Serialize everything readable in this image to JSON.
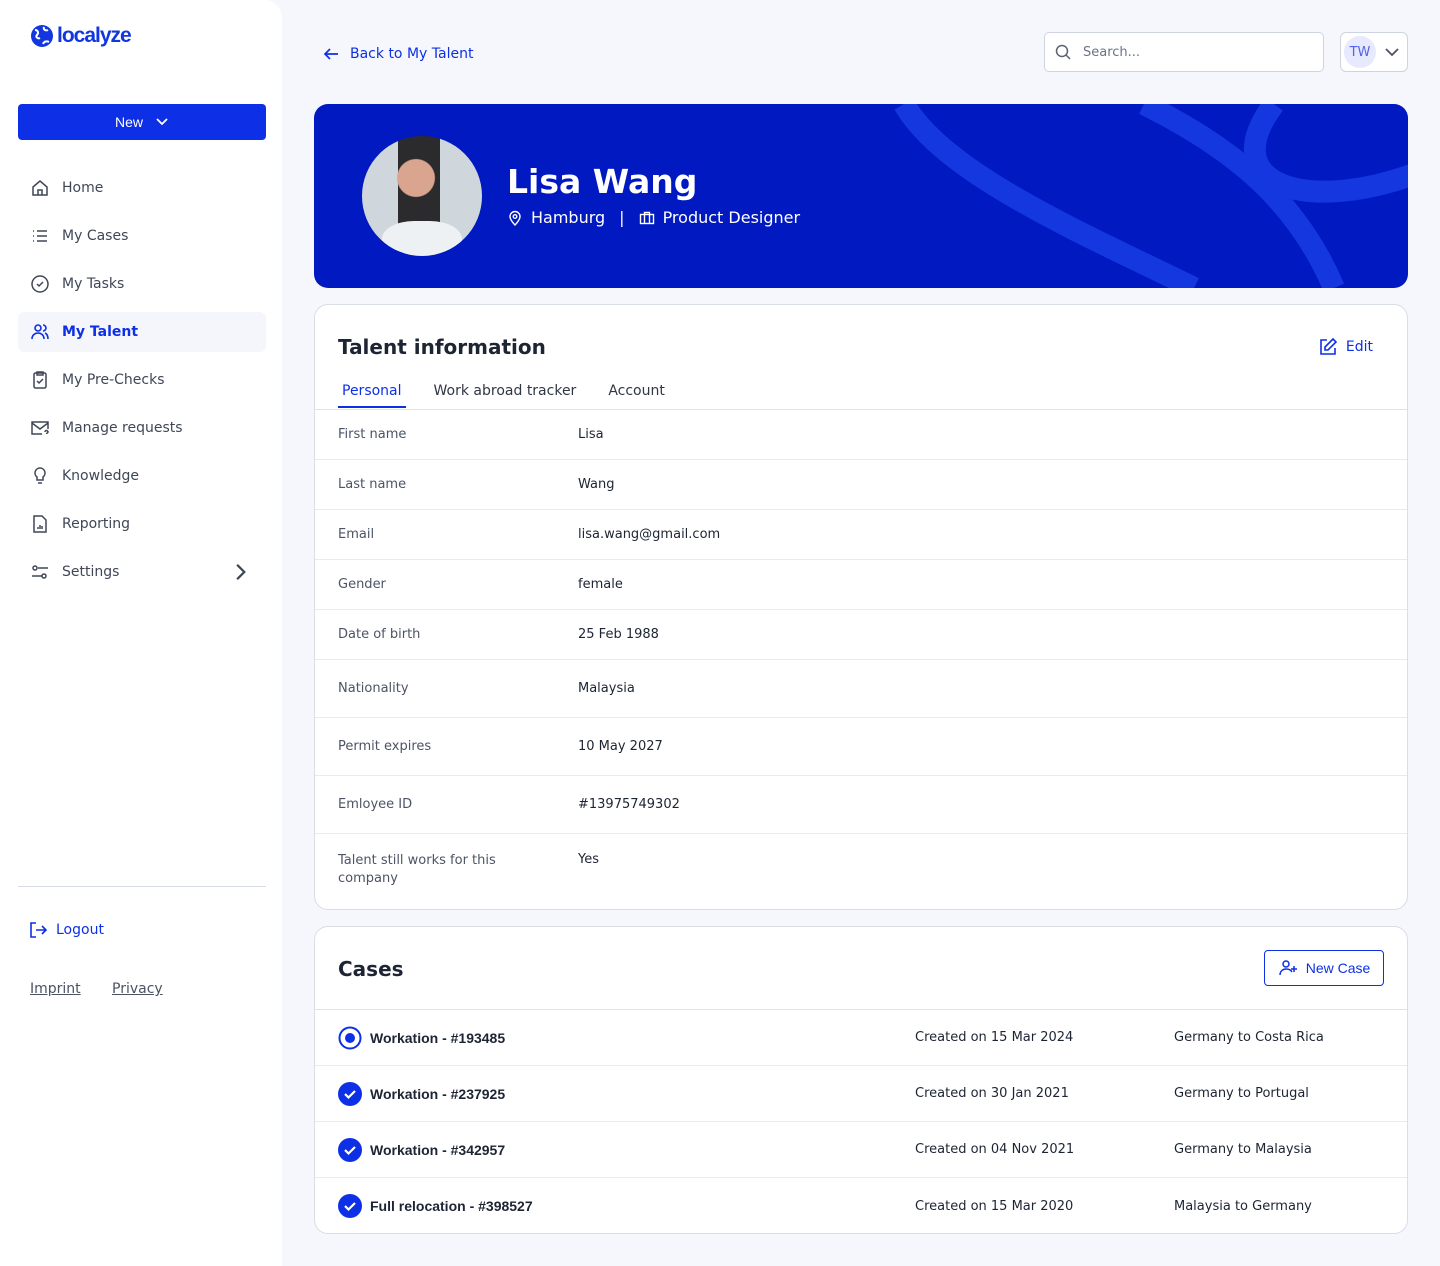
{
  "brand": {
    "name": "localyze",
    "accent": "#0d2fe6",
    "banner": "#0019c1"
  },
  "sidebar": {
    "new_label": "New",
    "items": [
      {
        "label": "Home",
        "icon": "home-icon"
      },
      {
        "label": "My Cases",
        "icon": "list-icon"
      },
      {
        "label": "My Tasks",
        "icon": "check-circle-icon"
      },
      {
        "label": "My Talent",
        "icon": "users-icon",
        "active": true
      },
      {
        "label": "My Pre-Checks",
        "icon": "clipboard-check-icon"
      },
      {
        "label": "Manage requests",
        "icon": "mail-question-icon"
      },
      {
        "label": "Knowledge",
        "icon": "lightbulb-icon"
      },
      {
        "label": "Reporting",
        "icon": "report-icon"
      },
      {
        "label": "Settings",
        "icon": "sliders-icon"
      }
    ],
    "logout": "Logout",
    "imprint": "Imprint",
    "privacy": "Privacy"
  },
  "header": {
    "back": "Back to My Talent",
    "search_placeholder": "Search...",
    "user_initials": "TW"
  },
  "profile": {
    "name": "Lisa Wang",
    "city": "Hamburg",
    "role": "Product Designer",
    "separator": "|"
  },
  "talent": {
    "title": "Talent information",
    "edit": "Edit",
    "tabs": [
      "Personal",
      "Work abroad tracker",
      "Account"
    ],
    "rows": [
      {
        "k": "First name",
        "v": "Lisa"
      },
      {
        "k": "Last name",
        "v": "Wang"
      },
      {
        "k": "Email",
        "v": "lisa.wang@gmail.com"
      },
      {
        "k": "Gender",
        "v": "female"
      },
      {
        "k": "Date of birth",
        "v": "25 Feb 1988"
      },
      {
        "k": "Nationality",
        "v": "Malaysia"
      },
      {
        "k": "Permit expires",
        "v": "10 May 2027"
      },
      {
        "k": "Emloyee ID",
        "v": "#13975749302"
      },
      {
        "k": "Talent still works for this company",
        "v": "Yes"
      }
    ]
  },
  "cases": {
    "title": "Cases",
    "new_case": "New Case",
    "items": [
      {
        "title": "Workation - #193485",
        "created": "Created on 15 Mar 2024",
        "route": "Germany to Costa Rica",
        "status": "in-progress"
      },
      {
        "title": "Workation - #237925",
        "created": "Created on 30 Jan 2021",
        "route": "Germany to Portugal",
        "status": "done"
      },
      {
        "title": "Workation - #342957",
        "created": "Created on 04 Nov 2021",
        "route": "Germany to Malaysia",
        "status": "done"
      },
      {
        "title": "Full relocation - #398527",
        "created": "Created on 15 Mar 2020",
        "route": "Malaysia to Germany",
        "status": "done"
      }
    ]
  }
}
